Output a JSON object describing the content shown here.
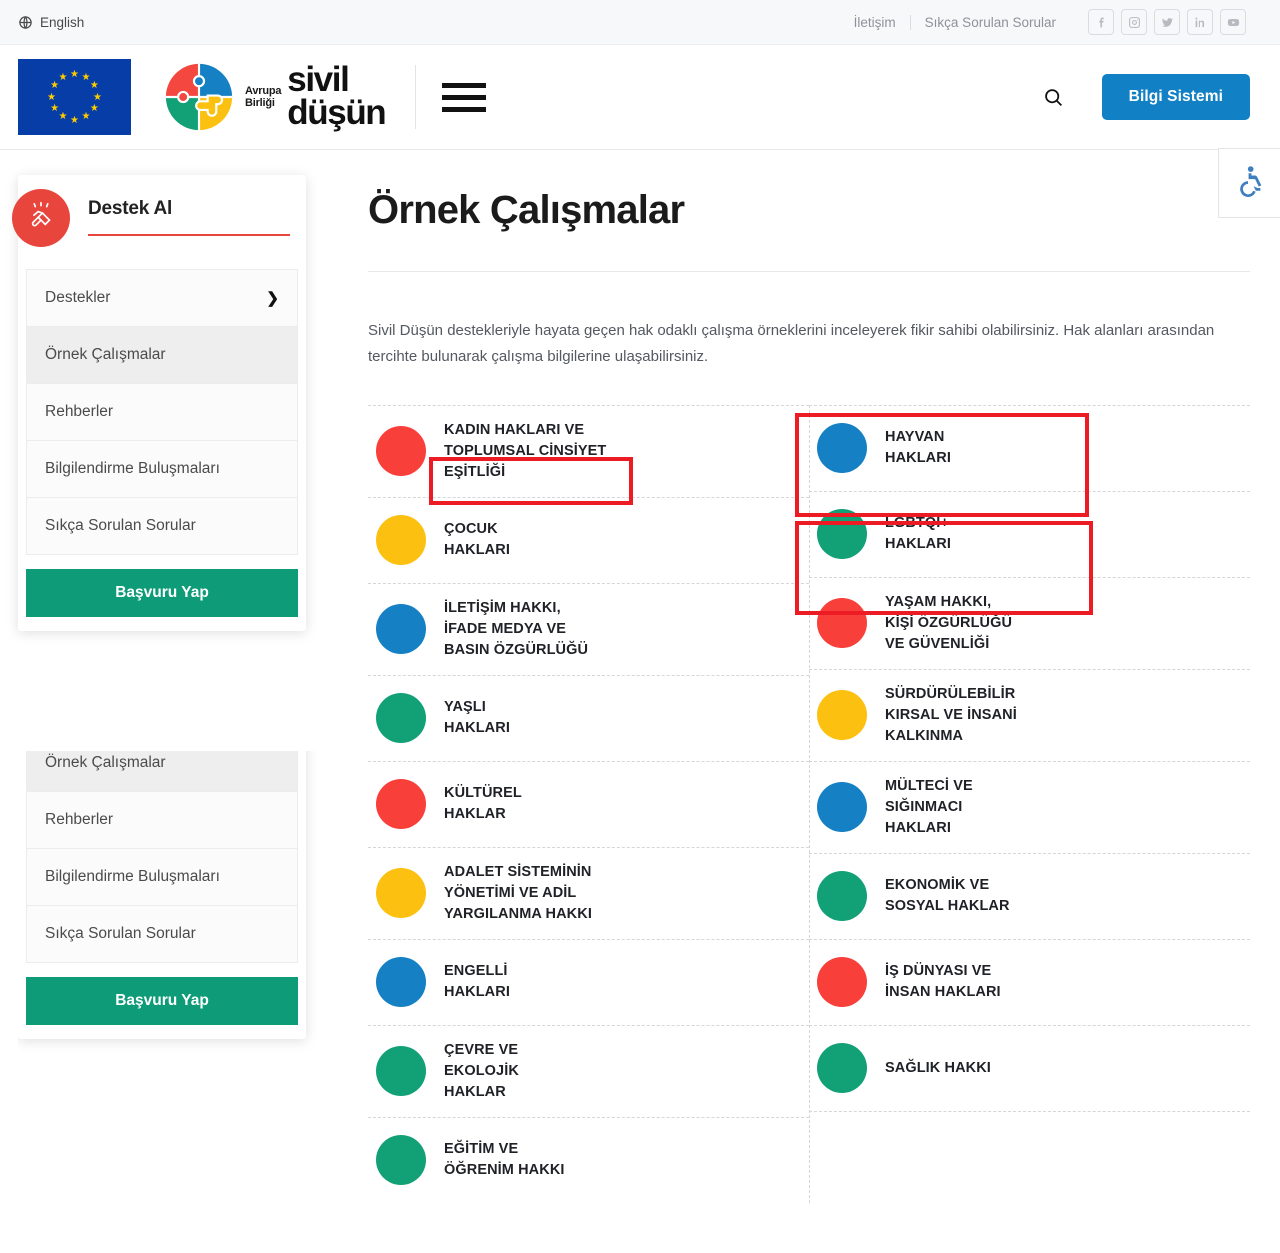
{
  "topbar": {
    "language": "English",
    "links": [
      {
        "label": "İletişim"
      },
      {
        "label": "Sıkça Sorulan Sorular"
      }
    ],
    "socials": [
      {
        "name": "facebook-icon"
      },
      {
        "name": "instagram-icon"
      },
      {
        "name": "twitter-icon"
      },
      {
        "name": "linkedin-icon"
      },
      {
        "name": "youtube-icon"
      }
    ]
  },
  "header": {
    "brand_sub_line1": "Avrupa",
    "brand_sub_line2": "Birliği",
    "brand_line1": "sivil",
    "brand_line2": "düşün",
    "cta_label": "Bilgi Sistemi",
    "cta_color": "#1280C4"
  },
  "sidebar": {
    "title": "Destek Al",
    "accent_color": "#E8453C",
    "items": [
      {
        "label": "Destekler",
        "chevron": "❯",
        "active": false,
        "expandable": true
      },
      {
        "label": "Örnek Çalışmalar",
        "active": true,
        "expandable": false
      },
      {
        "label": "Rehberler",
        "active": false,
        "expandable": false
      },
      {
        "label": "Bilgilendirme Buluşmaları",
        "active": false,
        "expandable": false
      },
      {
        "label": "Sıkça Sorulan Sorular",
        "active": false,
        "expandable": false
      }
    ],
    "apply_label": "Başvuru Yap",
    "apply_color": "#0E9B78"
  },
  "main": {
    "page_title": "Örnek Çalışmalar",
    "lede": "Sivil Düşün destekleriyle hayata geçen hak odaklı çalışma örneklerini inceleyerek fikir sahibi olabilirsiniz. Hak alanları arasından tercihte bulunarak çalışma bilgilerine ulaşabilirsiniz."
  },
  "palette": {
    "red": "#F93F3A",
    "yellow": "#FCC010",
    "blue": "#1580C4",
    "green": "#12A077",
    "annotation": "#ED1C24"
  },
  "categories_left": [
    {
      "label": "KADIN HAKLARI VE\nTOPLUMSAL CİNSİYET\nEŞİTLİĞİ",
      "color": "#F93F3A"
    },
    {
      "label": "ÇOCUK\nHAKLARI",
      "color": "#FCC010"
    },
    {
      "label": "İLETİŞİM HAKKI,\nİFADE MEDYA VE\nBASIN ÖZGÜRLÜĞÜ",
      "color": "#1580C4"
    },
    {
      "label": "YAŞLI\nHAKLARI",
      "color": "#12A077"
    },
    {
      "label": "KÜLTÜREL\nHAKLAR",
      "color": "#F93F3A"
    },
    {
      "label": "ADALET SİSTEMİNİN\nYÖNETİMİ VE ADİL\nYARGILANMA HAKKI",
      "color": "#FCC010"
    },
    {
      "label": "ENGELLİ\nHAKLARI",
      "color": "#1580C4"
    },
    {
      "label": "ÇEVRE VE\nEKOLOJİK\nHAKLAR",
      "color": "#12A077"
    },
    {
      "label": "EĞİTİM VE\nÖĞRENİM HAKKI",
      "color": "#12A077"
    }
  ],
  "categories_right": [
    {
      "label": "HAYVAN\nHAKLARI",
      "color": "#1580C4",
      "highlighted": true
    },
    {
      "label": "LGBTQI+\nHAKLARI",
      "color": "#12A077",
      "highlighted": true
    },
    {
      "label": "YAŞAM HAKKI,\nKİŞİ ÖZGÜRLÜĞÜ\nVE GÜVENLİĞİ",
      "color": "#F93F3A"
    },
    {
      "label": "SÜRDÜRÜLEBİLİR\nKIRSAL VE İNSANİ\nKALKINMA",
      "color": "#FCC010"
    },
    {
      "label": "MÜLTECİ VE\nSIĞINMACI\nHAKLARI",
      "color": "#1580C4"
    },
    {
      "label": "EKONOMİK VE\nSOSYAL HAKLAR",
      "color": "#12A077"
    },
    {
      "label": "İŞ DÜNYASI VE\nİNSAN HAKLARI",
      "color": "#F93F3A"
    },
    {
      "label": "SAĞLIK HAKKI",
      "color": "#12A077"
    }
  ]
}
